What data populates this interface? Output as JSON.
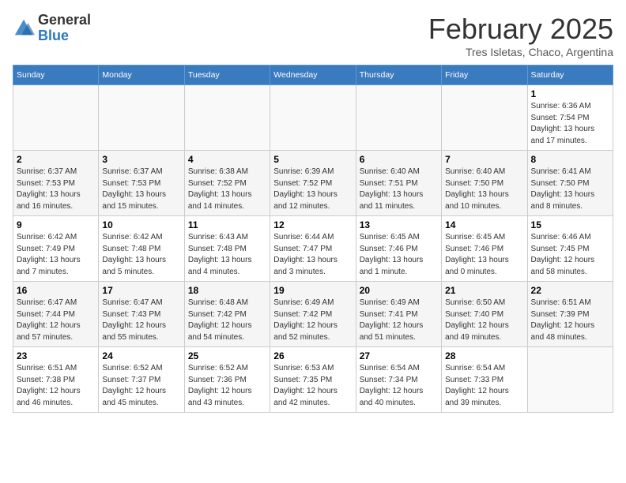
{
  "header": {
    "logo_general": "General",
    "logo_blue": "Blue",
    "month_title": "February 2025",
    "subtitle": "Tres Isletas, Chaco, Argentina"
  },
  "weekdays": [
    "Sunday",
    "Monday",
    "Tuesday",
    "Wednesday",
    "Thursday",
    "Friday",
    "Saturday"
  ],
  "weeks": [
    [
      {
        "day": "",
        "info": ""
      },
      {
        "day": "",
        "info": ""
      },
      {
        "day": "",
        "info": ""
      },
      {
        "day": "",
        "info": ""
      },
      {
        "day": "",
        "info": ""
      },
      {
        "day": "",
        "info": ""
      },
      {
        "day": "1",
        "info": "Sunrise: 6:36 AM\nSunset: 7:54 PM\nDaylight: 13 hours and 17 minutes."
      }
    ],
    [
      {
        "day": "2",
        "info": "Sunrise: 6:37 AM\nSunset: 7:53 PM\nDaylight: 13 hours and 16 minutes."
      },
      {
        "day": "3",
        "info": "Sunrise: 6:37 AM\nSunset: 7:53 PM\nDaylight: 13 hours and 15 minutes."
      },
      {
        "day": "4",
        "info": "Sunrise: 6:38 AM\nSunset: 7:52 PM\nDaylight: 13 hours and 14 minutes."
      },
      {
        "day": "5",
        "info": "Sunrise: 6:39 AM\nSunset: 7:52 PM\nDaylight: 13 hours and 12 minutes."
      },
      {
        "day": "6",
        "info": "Sunrise: 6:40 AM\nSunset: 7:51 PM\nDaylight: 13 hours and 11 minutes."
      },
      {
        "day": "7",
        "info": "Sunrise: 6:40 AM\nSunset: 7:50 PM\nDaylight: 13 hours and 10 minutes."
      },
      {
        "day": "8",
        "info": "Sunrise: 6:41 AM\nSunset: 7:50 PM\nDaylight: 13 hours and 8 minutes."
      }
    ],
    [
      {
        "day": "9",
        "info": "Sunrise: 6:42 AM\nSunset: 7:49 PM\nDaylight: 13 hours and 7 minutes."
      },
      {
        "day": "10",
        "info": "Sunrise: 6:42 AM\nSunset: 7:48 PM\nDaylight: 13 hours and 5 minutes."
      },
      {
        "day": "11",
        "info": "Sunrise: 6:43 AM\nSunset: 7:48 PM\nDaylight: 13 hours and 4 minutes."
      },
      {
        "day": "12",
        "info": "Sunrise: 6:44 AM\nSunset: 7:47 PM\nDaylight: 13 hours and 3 minutes."
      },
      {
        "day": "13",
        "info": "Sunrise: 6:45 AM\nSunset: 7:46 PM\nDaylight: 13 hours and 1 minute."
      },
      {
        "day": "14",
        "info": "Sunrise: 6:45 AM\nSunset: 7:46 PM\nDaylight: 13 hours and 0 minutes."
      },
      {
        "day": "15",
        "info": "Sunrise: 6:46 AM\nSunset: 7:45 PM\nDaylight: 12 hours and 58 minutes."
      }
    ],
    [
      {
        "day": "16",
        "info": "Sunrise: 6:47 AM\nSunset: 7:44 PM\nDaylight: 12 hours and 57 minutes."
      },
      {
        "day": "17",
        "info": "Sunrise: 6:47 AM\nSunset: 7:43 PM\nDaylight: 12 hours and 55 minutes."
      },
      {
        "day": "18",
        "info": "Sunrise: 6:48 AM\nSunset: 7:42 PM\nDaylight: 12 hours and 54 minutes."
      },
      {
        "day": "19",
        "info": "Sunrise: 6:49 AM\nSunset: 7:42 PM\nDaylight: 12 hours and 52 minutes."
      },
      {
        "day": "20",
        "info": "Sunrise: 6:49 AM\nSunset: 7:41 PM\nDaylight: 12 hours and 51 minutes."
      },
      {
        "day": "21",
        "info": "Sunrise: 6:50 AM\nSunset: 7:40 PM\nDaylight: 12 hours and 49 minutes."
      },
      {
        "day": "22",
        "info": "Sunrise: 6:51 AM\nSunset: 7:39 PM\nDaylight: 12 hours and 48 minutes."
      }
    ],
    [
      {
        "day": "23",
        "info": "Sunrise: 6:51 AM\nSunset: 7:38 PM\nDaylight: 12 hours and 46 minutes."
      },
      {
        "day": "24",
        "info": "Sunrise: 6:52 AM\nSunset: 7:37 PM\nDaylight: 12 hours and 45 minutes."
      },
      {
        "day": "25",
        "info": "Sunrise: 6:52 AM\nSunset: 7:36 PM\nDaylight: 12 hours and 43 minutes."
      },
      {
        "day": "26",
        "info": "Sunrise: 6:53 AM\nSunset: 7:35 PM\nDaylight: 12 hours and 42 minutes."
      },
      {
        "day": "27",
        "info": "Sunrise: 6:54 AM\nSunset: 7:34 PM\nDaylight: 12 hours and 40 minutes."
      },
      {
        "day": "28",
        "info": "Sunrise: 6:54 AM\nSunset: 7:33 PM\nDaylight: 12 hours and 39 minutes."
      },
      {
        "day": "",
        "info": ""
      }
    ]
  ]
}
